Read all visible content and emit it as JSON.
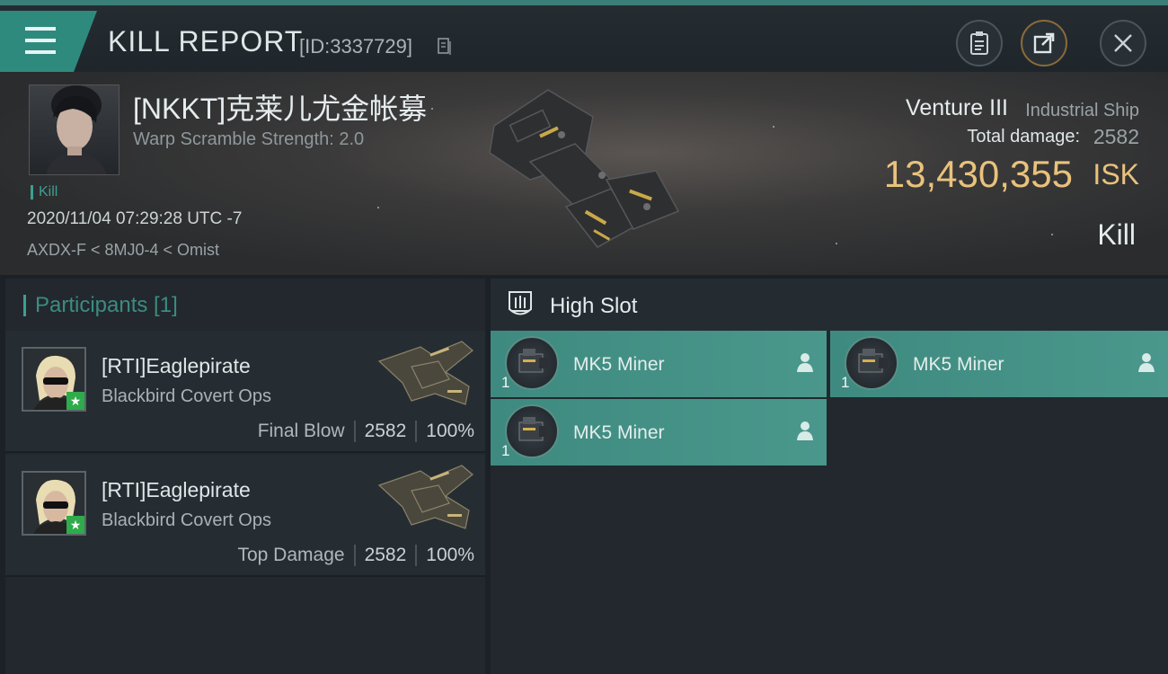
{
  "header": {
    "title": "KILL REPORT",
    "report_id": "[ID:3337729]"
  },
  "victim": {
    "name": "[NKKT]克莱儿尤金帐募",
    "warp_scramble": "Warp Scramble Strength: 2.0",
    "tag": "Kill",
    "datetime": "2020/11/04 07:29:28 UTC -7",
    "location": "AXDX-F < 8MJ0-4 < Omist"
  },
  "ship": {
    "name": "Venture III",
    "class": "Industrial Ship",
    "total_damage_label": "Total damage:",
    "total_damage": "2582",
    "isk_value": "13,430,355",
    "isk_unit": "ISK",
    "result": "Kill"
  },
  "participants": {
    "header": "Participants [1]",
    "rows": [
      {
        "name": "[RTI]Eaglepirate",
        "ship": "Blackbird Covert Ops",
        "label": "Final Blow",
        "damage": "2582",
        "percent": "100%"
      },
      {
        "name": "[RTI]Eaglepirate",
        "ship": "Blackbird Covert Ops",
        "label": "Top Damage",
        "damage": "2582",
        "percent": "100%"
      }
    ]
  },
  "high_slot": {
    "title": "High Slot",
    "modules": [
      {
        "name": "MK5 Miner",
        "qty": "1"
      },
      {
        "name": "MK5 Miner",
        "qty": "1"
      },
      {
        "name": "MK5 Miner",
        "qty": "1"
      }
    ]
  },
  "colors": {
    "accent": "#3f9e92",
    "isk": "#e9c27c",
    "module_bg": "#468f85"
  }
}
